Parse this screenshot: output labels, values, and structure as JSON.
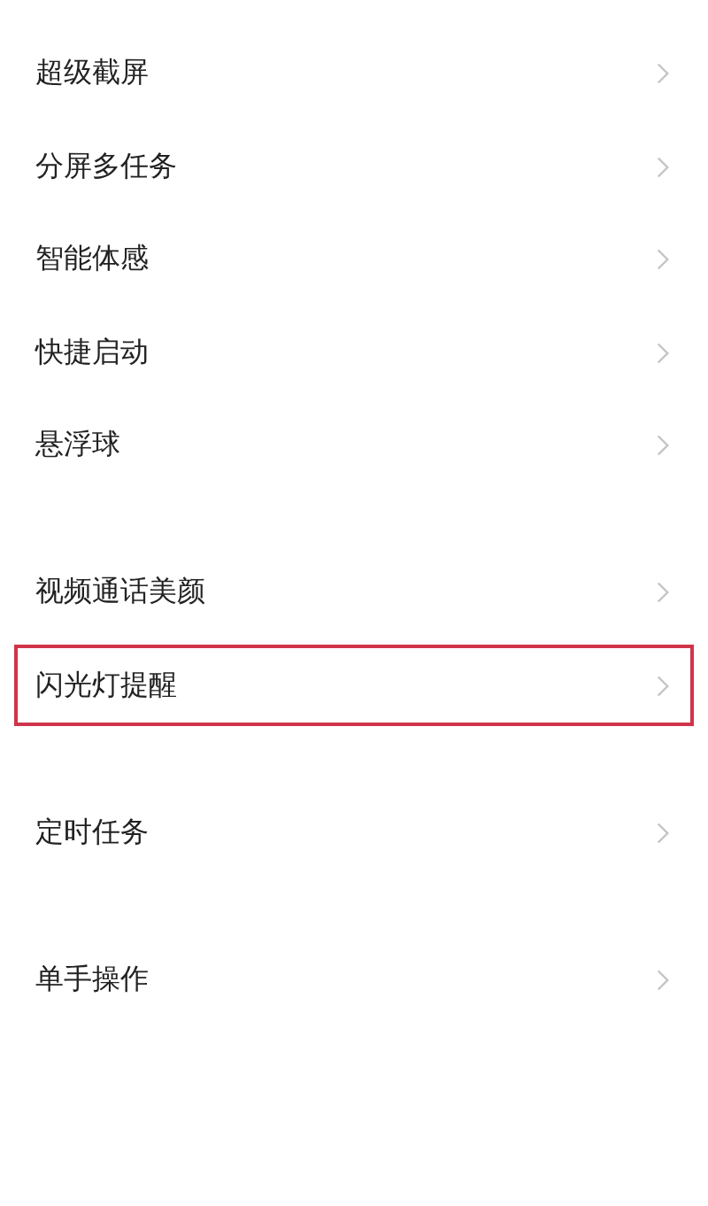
{
  "groups": [
    {
      "items": [
        {
          "label": "超级截屏",
          "highlighted": false
        },
        {
          "label": "分屏多任务",
          "highlighted": false
        },
        {
          "label": "智能体感",
          "highlighted": false
        },
        {
          "label": "快捷启动",
          "highlighted": false
        },
        {
          "label": "悬浮球",
          "highlighted": false
        }
      ]
    },
    {
      "items": [
        {
          "label": "视频通话美颜",
          "highlighted": false
        },
        {
          "label": "闪光灯提醒",
          "highlighted": true
        }
      ]
    },
    {
      "items": [
        {
          "label": "定时任务",
          "highlighted": false
        }
      ]
    },
    {
      "items": [
        {
          "label": "单手操作",
          "highlighted": false
        }
      ]
    }
  ]
}
